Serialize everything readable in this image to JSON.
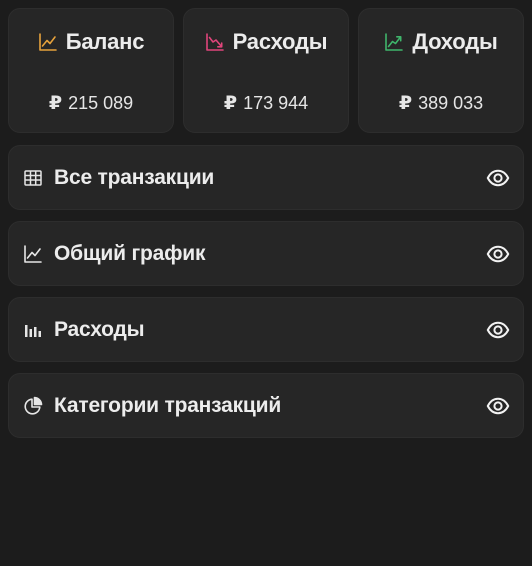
{
  "stats": [
    {
      "label": "Баланс",
      "currency": "₽",
      "value": "215 089",
      "icon": "trend-icon",
      "color": "#e6a23c"
    },
    {
      "label": "Расходы",
      "currency": "₽",
      "value": "173 944",
      "icon": "trend-down-icon",
      "color": "#e0457b"
    },
    {
      "label": "Доходы",
      "currency": "₽",
      "value": "389 033",
      "icon": "trend-up-icon",
      "color": "#3fb56b"
    }
  ],
  "sections": [
    {
      "label": "Все транзакции",
      "icon": "table-icon"
    },
    {
      "label": "Общий график",
      "icon": "line-chart-icon"
    },
    {
      "label": "Расходы",
      "icon": "bar-chart-icon"
    },
    {
      "label": "Категории транзакций",
      "icon": "pie-chart-icon"
    }
  ],
  "colors": {
    "background": "#1c1c1c",
    "card": "#262626",
    "text": "#ececec"
  }
}
